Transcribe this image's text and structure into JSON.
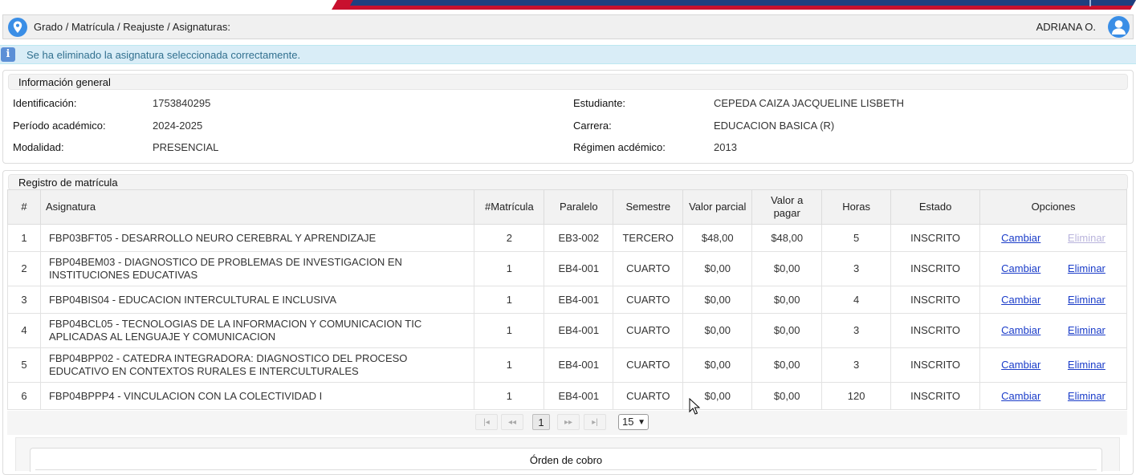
{
  "header": {
    "breadcrumb": "Grado / Matrícula / Reajuste / Asignaturas:",
    "user_name": "ADRIANA O."
  },
  "alert": {
    "message": "Se ha eliminado la asignatura seleccionada correctamente."
  },
  "general_info": {
    "title": "Información general",
    "fields": [
      {
        "label": "Identificación:",
        "value": "1753840295"
      },
      {
        "label": "Período académico:",
        "value": "2024-2025"
      },
      {
        "label": "Modalidad:",
        "value": "PRESENCIAL"
      },
      {
        "label": "Estudiante:",
        "value": "CEPEDA CAIZA JACQUELINE LISBETH"
      },
      {
        "label": "Carrera:",
        "value": "EDUCACION BASICA (R)"
      },
      {
        "label": "Régimen acdémico:",
        "value": "2013"
      }
    ]
  },
  "registration": {
    "title": "Registro de matrícula",
    "columns": [
      "#",
      "Asignatura",
      "#Matrícula",
      "Paralelo",
      "Semestre",
      "Valor parcial",
      "Valor a pagar",
      "Horas",
      "Estado",
      "Opciones"
    ],
    "change_label": "Cambiar",
    "delete_label": "Eliminar",
    "rows": [
      {
        "n": "1",
        "subject": "FBP03BFT05 - DESARROLLO NEURO CEREBRAL Y APRENDIZAJE",
        "enrollment": "2",
        "parallel": "EB3-002",
        "semester": "TERCERO",
        "partial": "$48,00",
        "to_pay": "$48,00",
        "hours": "5",
        "status": "INSCRITO",
        "delete_enabled": false
      },
      {
        "n": "2",
        "subject": "FBP04BEM03 - DIAGNOSTICO DE PROBLEMAS DE INVESTIGACION EN INSTITUCIONES EDUCATIVAS",
        "enrollment": "1",
        "parallel": "EB4-001",
        "semester": "CUARTO",
        "partial": "$0,00",
        "to_pay": "$0,00",
        "hours": "3",
        "status": "INSCRITO",
        "delete_enabled": true
      },
      {
        "n": "3",
        "subject": "FBP04BIS04 - EDUCACION INTERCULTURAL E INCLUSIVA",
        "enrollment": "1",
        "parallel": "EB4-001",
        "semester": "CUARTO",
        "partial": "$0,00",
        "to_pay": "$0,00",
        "hours": "4",
        "status": "INSCRITO",
        "delete_enabled": true
      },
      {
        "n": "4",
        "subject": "FBP04BCL05 - TECNOLOGIAS DE LA INFORMACION Y COMUNICACION TIC APLICADAS AL LENGUAJE Y COMUNICACION",
        "enrollment": "1",
        "parallel": "EB4-001",
        "semester": "CUARTO",
        "partial": "$0,00",
        "to_pay": "$0,00",
        "hours": "3",
        "status": "INSCRITO",
        "delete_enabled": true
      },
      {
        "n": "5",
        "subject": "FBP04BPP02 - CATEDRA INTEGRADORA: DIAGNOSTICO DEL PROCESO EDUCATIVO EN CONTEXTOS RURALES E INTERCULTURALES",
        "enrollment": "1",
        "parallel": "EB4-001",
        "semester": "CUARTO",
        "partial": "$0,00",
        "to_pay": "$0,00",
        "hours": "3",
        "status": "INSCRITO",
        "delete_enabled": true
      },
      {
        "n": "6",
        "subject": "FBP04BPPP4 - VINCULACION CON LA COLECTIVIDAD I",
        "enrollment": "1",
        "parallel": "EB4-001",
        "semester": "CUARTO",
        "partial": "$0,00",
        "to_pay": "$0,00",
        "hours": "120",
        "status": "INSCRITO",
        "delete_enabled": true
      }
    ]
  },
  "pager": {
    "current_page": "1",
    "page_size": "15"
  },
  "payment_order": {
    "title": "Órden de cobro"
  }
}
